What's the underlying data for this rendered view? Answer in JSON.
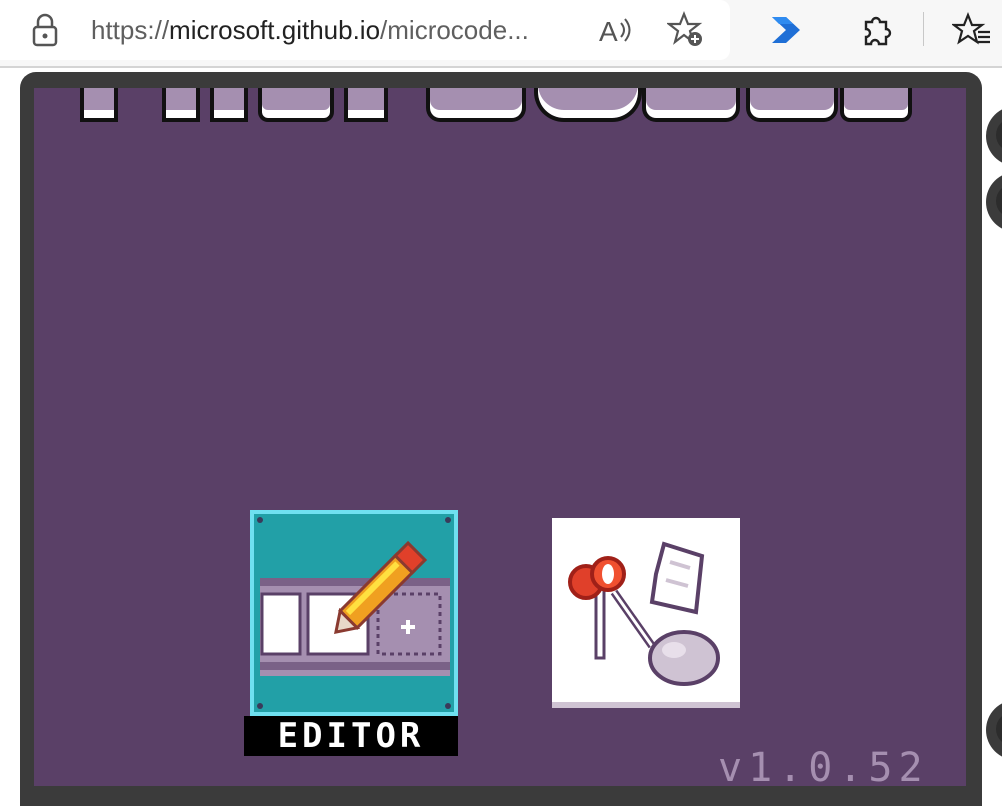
{
  "browser": {
    "url_scheme": "https://",
    "url_domain": "microsoft.github.io",
    "url_rest": "/microcode...",
    "icons": [
      "lock-icon",
      "read-aloud-icon",
      "favorite-add-icon",
      "power-automate-icon",
      "extensions-icon",
      "favorites-icon"
    ]
  },
  "app": {
    "editor_label": "EDITOR",
    "version": "v1.0.52",
    "colors": {
      "screen_bg": "#5a4067",
      "editor_tile": "#22a0a7",
      "editor_border": "#6fe0f0",
      "logo": "#a58fb0"
    }
  }
}
